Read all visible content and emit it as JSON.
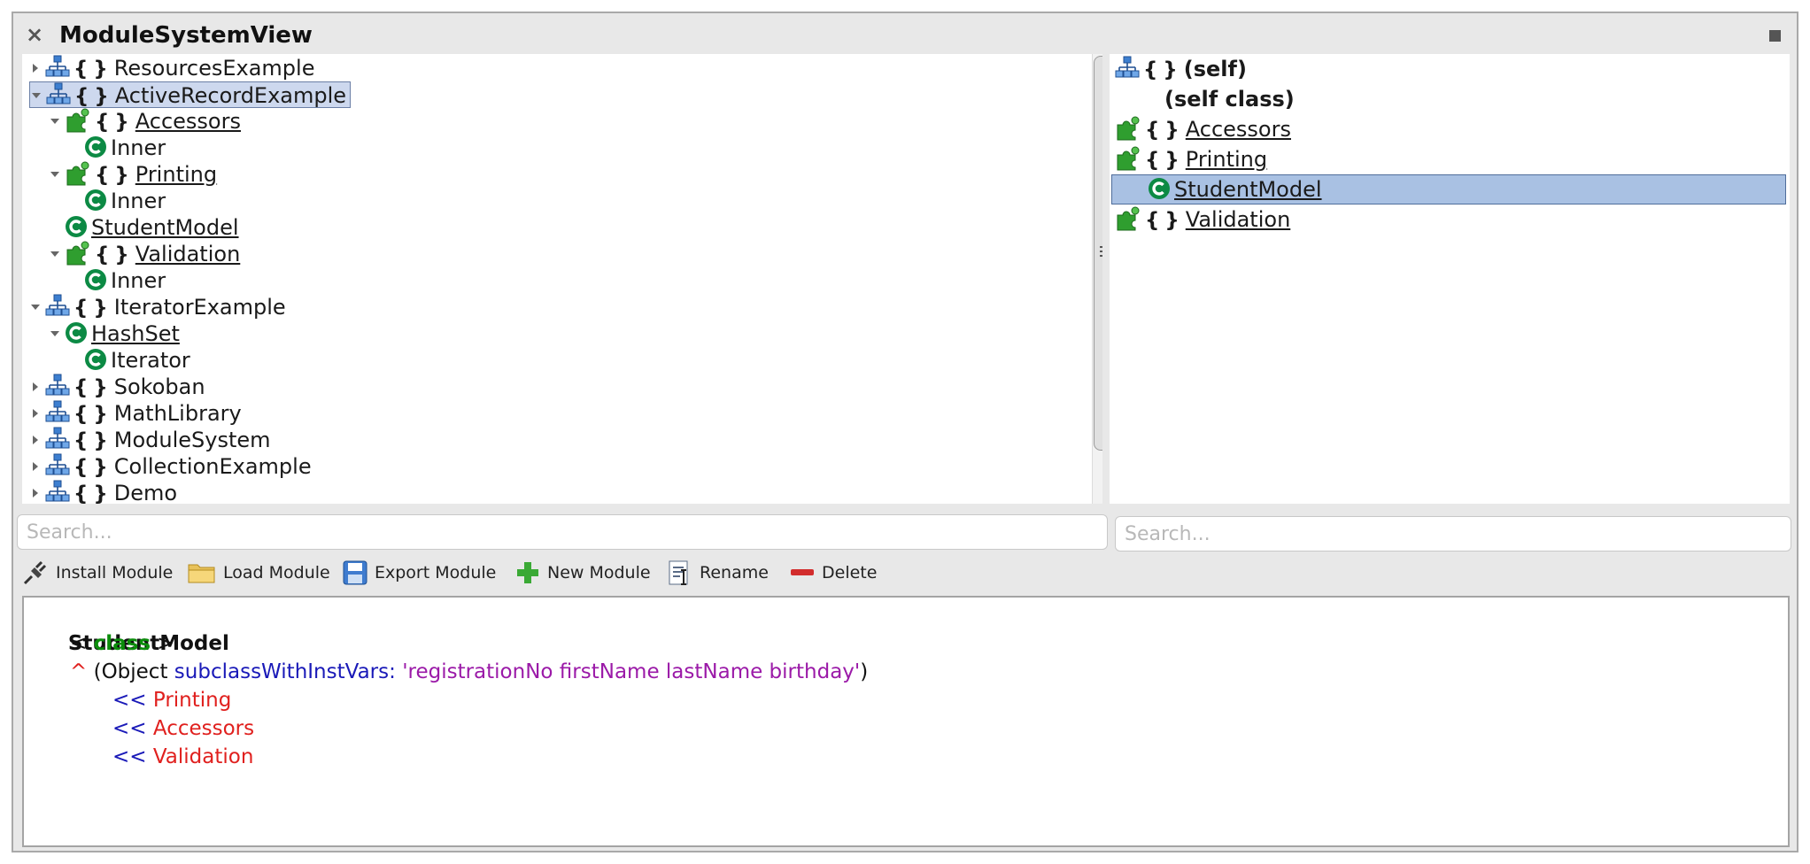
{
  "window": {
    "title": "ModuleSystemView"
  },
  "left_tree": {
    "items": [
      {
        "label": "ResourcesExample",
        "expanded": false,
        "icon": "module-icon",
        "braces": "{}"
      },
      {
        "label": "ActiveRecordExample",
        "expanded": true,
        "selected": true,
        "icon": "module-icon",
        "braces": "{}"
      },
      {
        "label": "Accessors",
        "expanded": true,
        "icon": "trait-icon",
        "braces": "{}"
      },
      {
        "label": "Inner",
        "icon": "class-icon"
      },
      {
        "label": "Printing",
        "expanded": true,
        "icon": "trait-icon",
        "braces": "{}"
      },
      {
        "label": "Inner",
        "icon": "class-icon"
      },
      {
        "label": "StudentModel",
        "icon": "class-icon"
      },
      {
        "label": "Validation",
        "expanded": true,
        "icon": "trait-icon",
        "braces": "{}"
      },
      {
        "label": "Inner",
        "icon": "class-icon"
      },
      {
        "label": "IteratorExample",
        "expanded": true,
        "icon": "module-icon",
        "braces": "{}"
      },
      {
        "label": "HashSet",
        "expanded": true,
        "icon": "class-icon"
      },
      {
        "label": "Iterator",
        "icon": "class-icon"
      },
      {
        "label": "Sokoban",
        "expanded": false,
        "icon": "module-icon",
        "braces": "{}"
      },
      {
        "label": "MathLibrary",
        "expanded": false,
        "icon": "module-icon",
        "braces": "{}"
      },
      {
        "label": "ModuleSystem",
        "expanded": false,
        "icon": "module-icon",
        "braces": "{}"
      },
      {
        "label": "CollectionExample",
        "expanded": false,
        "icon": "module-icon",
        "braces": "{}"
      },
      {
        "label": "Demo",
        "expanded": false,
        "icon": "module-icon",
        "braces": "{}"
      }
    ],
    "search_placeholder": "Search..."
  },
  "right_list": {
    "items": [
      {
        "label": "(self)",
        "icon": "module-icon",
        "braces": "{}"
      },
      {
        "label": "(self class)"
      },
      {
        "label": "Accessors",
        "icon": "trait-icon",
        "braces": "{}"
      },
      {
        "label": "Printing",
        "icon": "trait-icon",
        "braces": "{}"
      },
      {
        "label": "StudentModel",
        "icon": "class-icon",
        "selected": true
      },
      {
        "label": "Validation",
        "icon": "trait-icon",
        "braces": "{}"
      }
    ],
    "search_placeholder": "Search..."
  },
  "toolbar": {
    "install": "Install Module",
    "load": "Load Module",
    "export": "Export Module",
    "new": "New Module",
    "rename": "Rename",
    "delete": "Delete"
  },
  "editor": {
    "name": "StudentModel",
    "lt": "<",
    "keyword": "class",
    "gt": ">",
    "caret": "^",
    "open_paren": "(Object",
    "selector": "subclassWithInstVars:",
    "string": "'registrationNo firstName lastName birthday'",
    "close_paren": ")",
    "mixins": [
      {
        "op": "<<",
        "name": "Printing"
      },
      {
        "op": "<<",
        "name": "Accessors"
      },
      {
        "op": "<<",
        "name": "Validation"
      }
    ]
  },
  "colors": {
    "module_icon": "#3d7fd0",
    "trait_icon": "#2f9e2f",
    "class_icon": "#0c8a44",
    "keyword": "#0b8d0b",
    "mixin_name": "#e0201e",
    "selector": "#1a1ab8",
    "string": "#9b1aa8"
  }
}
